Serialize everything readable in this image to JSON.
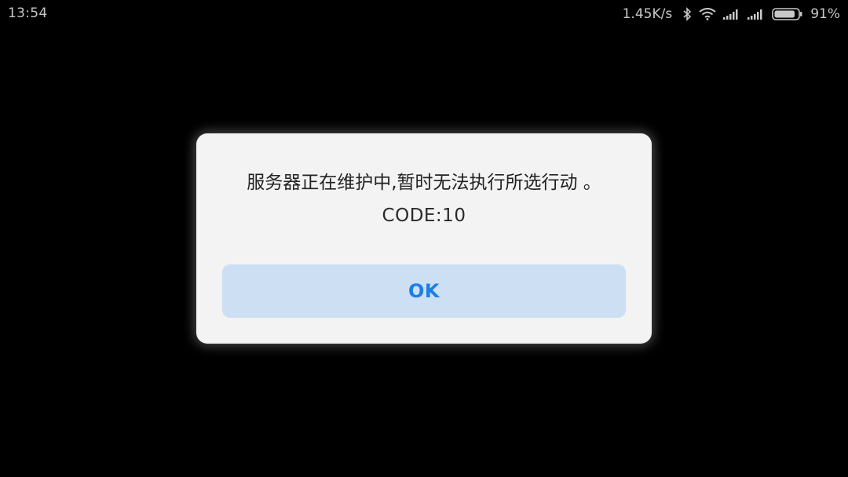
{
  "status_bar": {
    "time": "13:54",
    "net_speed": "1.45K/s",
    "battery_percent": "91%",
    "battery_level": 0.91,
    "icons": [
      "bluetooth-icon",
      "wifi-icon",
      "signal-icon",
      "signal-icon",
      "battery-icon"
    ]
  },
  "dialog": {
    "message": "服务器正在维护中,暂时无法执行所选行动 。",
    "code": "CODE:10",
    "ok_label": "OK"
  },
  "colors": {
    "background": "#000000",
    "dialog_bg": "#f3f3f3",
    "button_bg": "#ccdff3",
    "button_text": "#1a7fe6"
  }
}
